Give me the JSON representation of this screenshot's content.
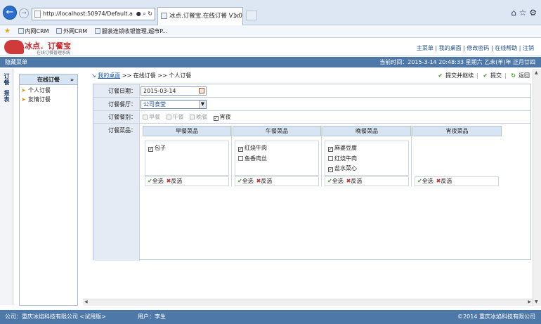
{
  "browser": {
    "url": "http://localhost:50974/Default.a",
    "tab_title": "冰点.订餐宝.在线订餐 V1.0",
    "favorites": [
      "内网CRM",
      "外网CRM",
      "服装连锁收银管理,超市P..."
    ]
  },
  "app": {
    "logo_title": "冰点．订餐宝",
    "logo_subtitle": "在线订餐管理系统",
    "top_menu": "主菜单 | 我的桌面 | 修改密码 | 在线帮助 | 注销",
    "hide_menu": "隐藏菜单",
    "current_time": "当前时间：2015-3-14 20:48:33 星期六 乙未(羊)年 正月廿四"
  },
  "vtabs": [
    "订餐",
    "报表"
  ],
  "left_panel": {
    "title": "在线订餐",
    "items": [
      "个人订餐",
      "友情订餐"
    ]
  },
  "breadcrumb": {
    "home": "我的桌面",
    "rest": " >> 在线订餐 >> 个人订餐"
  },
  "actions": {
    "submit_continue": "提交并继续",
    "submit": "提交",
    "back": "返回"
  },
  "form": {
    "date_label": "订餐日期：",
    "date_value": "2015-03-14",
    "canteen_label": "订餐餐厅：",
    "canteen_value": "公司食堂",
    "meal_type_label": "订餐餐别：",
    "meal_types": [
      "早餐",
      "午餐",
      "晚餐",
      "宵夜"
    ],
    "dishes_label": "订餐菜品：",
    "columns": [
      {
        "title": "早餐菜品",
        "dishes": [
          "包子"
        ]
      },
      {
        "title": "午餐菜品",
        "dishes": [
          "红烧牛肉",
          "鱼香肉丝"
        ]
      },
      {
        "title": "晚餐菜品",
        "dishes": [
          "麻婆豆腐",
          "红烧牛肉",
          "盐水菜心"
        ]
      },
      {
        "title": "宵夜菜品",
        "dishes": []
      }
    ],
    "select_all": "全选",
    "invert": "反选"
  },
  "footer": {
    "company": "公司：重庆冰焰科技有限公司 <试用版>",
    "user": "用户：李生",
    "copyright": "©2014 重庆冰焰科技有限公司"
  }
}
